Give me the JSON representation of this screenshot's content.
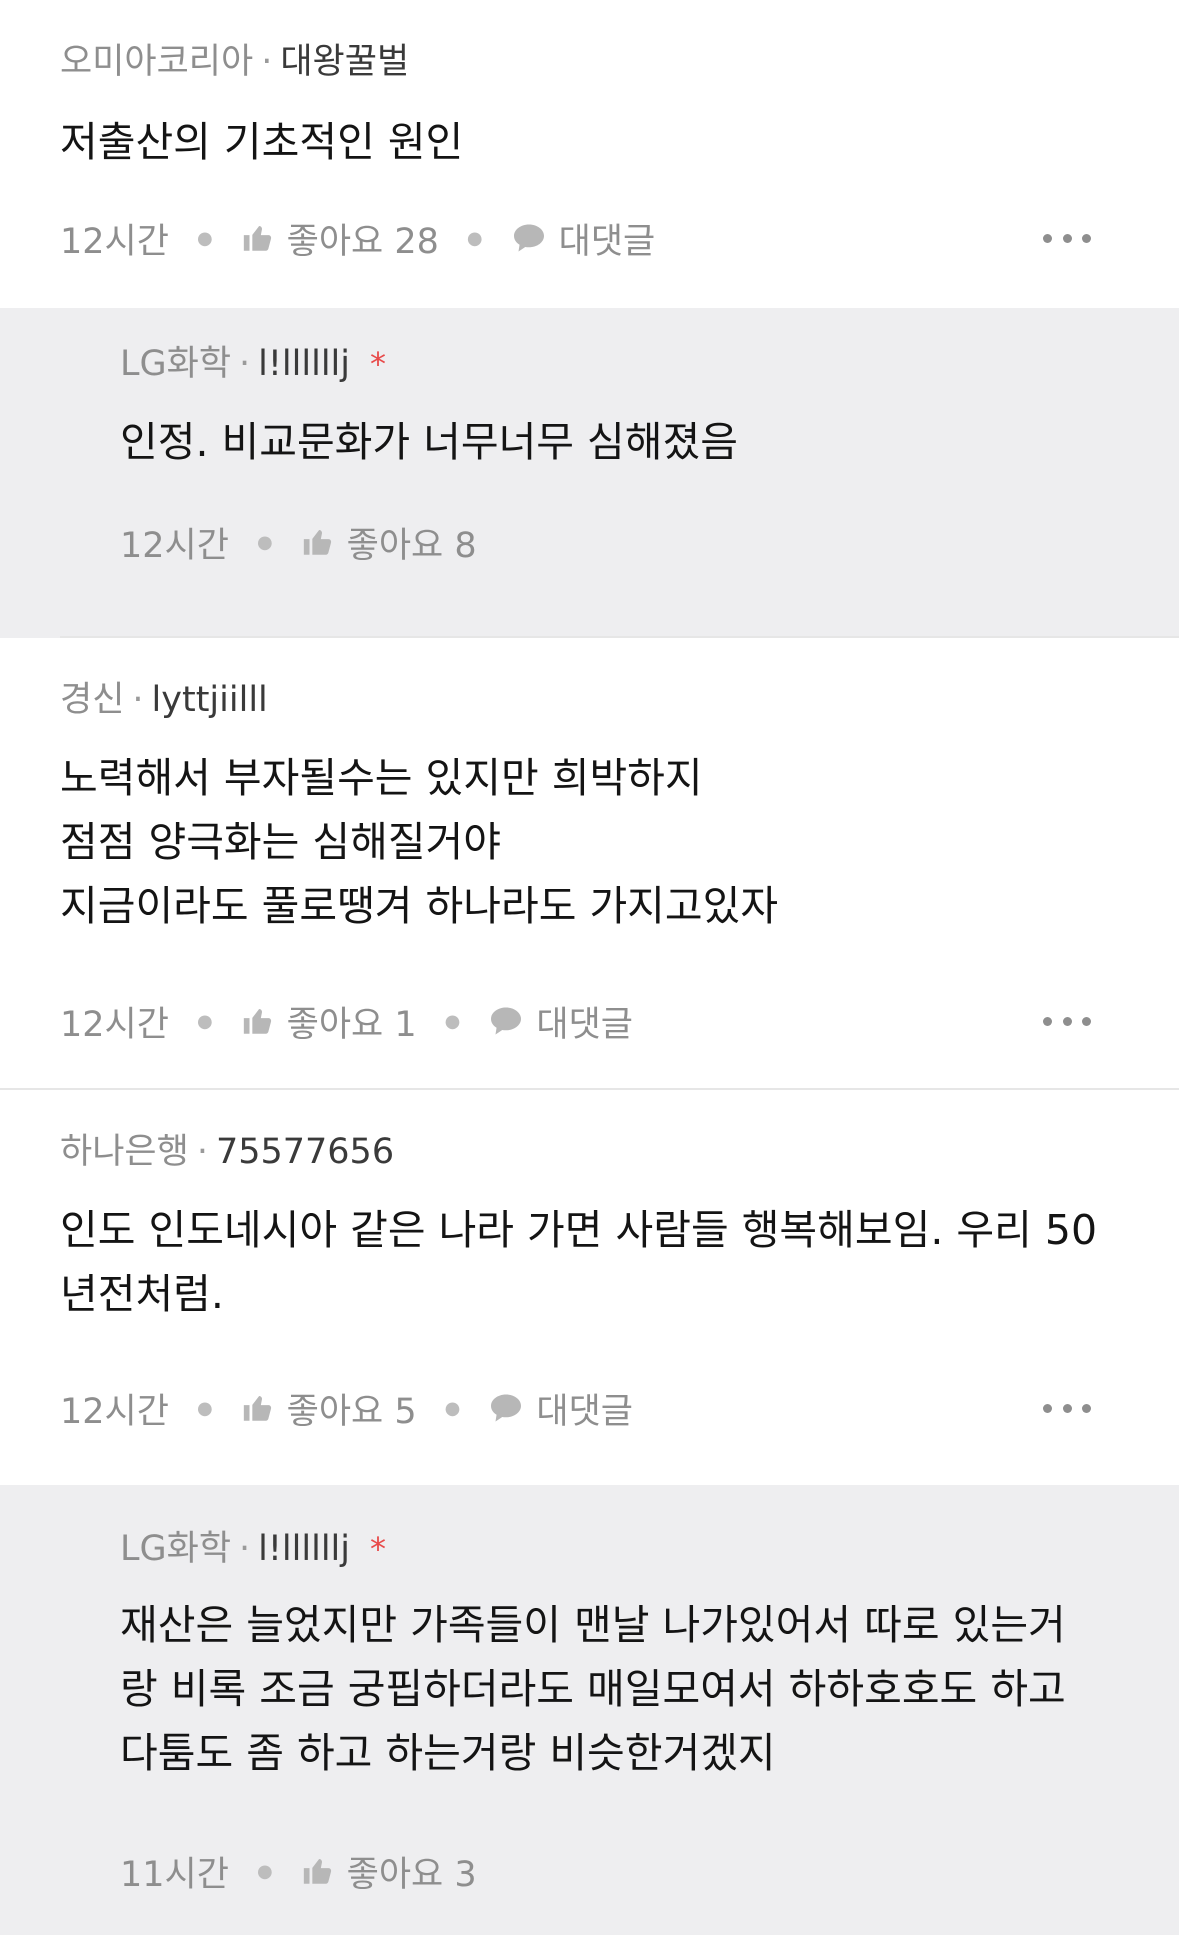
{
  "comments": [
    {
      "company": "오미아코리아",
      "user": "대왕꿀벌",
      "badge": "",
      "lines": [
        "저출산의 기초적인 원인"
      ],
      "time": "12시간",
      "like_label": "좋아요 28",
      "reply_label": "대댓글",
      "is_reply": false
    },
    {
      "company": "LG화학",
      "user": "l!llllllj",
      "badge": "*",
      "lines": [
        "인정. 비교문화가 너무너무 심해졌음"
      ],
      "time": "12시간",
      "like_label": "좋아요 8",
      "reply_label": "",
      "is_reply": true
    },
    {
      "company": "경신",
      "user": "lyttjiilll",
      "badge": "",
      "lines": [
        "노력해서 부자될수는 있지만 희박하지",
        "점점 양극화는 심해질거야",
        "지금이라도 풀로땡겨 하나라도 가지고있자"
      ],
      "time": "12시간",
      "like_label": "좋아요 1",
      "reply_label": "대댓글",
      "is_reply": false
    },
    {
      "company": "하나은행",
      "user": "75577656",
      "badge": "",
      "lines": [
        "인도 인도네시아 같은 나라 가면 사람들 행복해보임. 우리 50",
        "년전처럼."
      ],
      "time": "12시간",
      "like_label": "좋아요 5",
      "reply_label": "대댓글",
      "is_reply": false
    },
    {
      "company": "LG화학",
      "user": "l!llllllj",
      "badge": "*",
      "lines": [
        "재산은 늘었지만 가족들이 맨날 나가있어서 따로 있는거",
        "랑 비록 조금 궁핍하더라도 매일모여서 하하호호도 하고",
        "다툼도 좀 하고 하는거랑 비슷한거겠지"
      ],
      "time": "11시간",
      "like_label": "좋아요 3",
      "reply_label": "",
      "is_reply": true
    }
  ]
}
